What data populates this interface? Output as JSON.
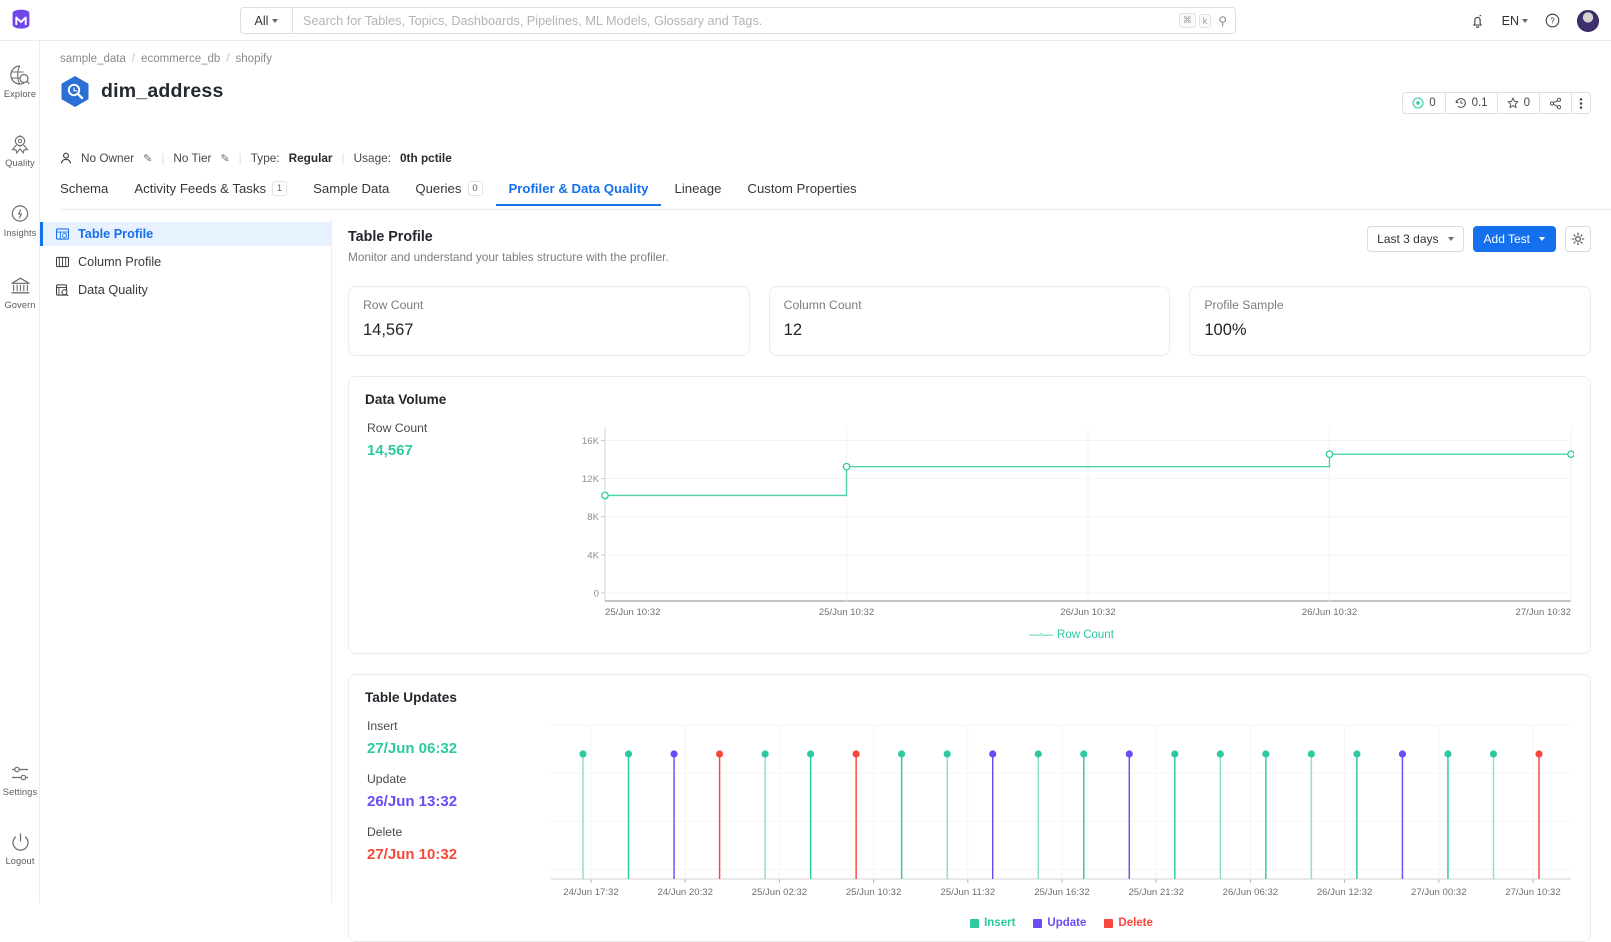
{
  "topbar": {
    "logo_name": "openmetadata-logo",
    "search_scope": "All",
    "search_placeholder": "Search for Tables, Topics, Dashboards, Pipelines, ML Models, Glossary and Tags.",
    "kbd_primary": "⌘",
    "kbd_secondary": "k",
    "bell_icon": "notification-bell-icon",
    "language": "EN",
    "help_icon": "help-circle-icon",
    "avatar_name": "user-avatar"
  },
  "rail": {
    "items": [
      {
        "label": "Explore",
        "icon": "globe-search-icon"
      },
      {
        "label": "Quality",
        "icon": "quality-badge-icon"
      },
      {
        "label": "Insights",
        "icon": "lightbulb-icon"
      },
      {
        "label": "Govern",
        "icon": "bank-icon"
      }
    ],
    "bottom": [
      {
        "label": "Settings",
        "icon": "settings-slider-icon"
      },
      {
        "label": "Logout",
        "icon": "logout-icon"
      }
    ]
  },
  "breadcrumb": [
    "sample_data",
    "ecommerce_db",
    "shopify"
  ],
  "entity": {
    "name": "dim_address",
    "icon": "bigquery-service-icon",
    "owner": "No Owner",
    "tier": "No Tier",
    "type_label": "Type:",
    "type_value": "Regular",
    "usage_label": "Usage:",
    "usage_value": "0th pctile"
  },
  "actionbar": {
    "items": [
      {
        "name": "announcement-count",
        "icon": "target-icon",
        "value": "0"
      },
      {
        "name": "version-count",
        "icon": "history-icon",
        "value": "0.1"
      },
      {
        "name": "follower-count",
        "icon": "star-icon",
        "value": "0"
      },
      {
        "name": "share-button",
        "icon": "share-icon",
        "value": ""
      },
      {
        "name": "more-menu",
        "icon": "kebab-menu-icon",
        "value": ""
      }
    ]
  },
  "tabs": [
    {
      "label": "Schema",
      "active": false,
      "count": null
    },
    {
      "label": "Activity Feeds & Tasks",
      "active": false,
      "count": "1"
    },
    {
      "label": "Sample Data",
      "active": false,
      "count": null
    },
    {
      "label": "Queries",
      "active": false,
      "count": "0"
    },
    {
      "label": "Profiler & Data Quality",
      "active": true,
      "count": null
    },
    {
      "label": "Lineage",
      "active": false,
      "count": null
    },
    {
      "label": "Custom Properties",
      "active": false,
      "count": null
    }
  ],
  "leftnav": [
    {
      "label": "Table Profile",
      "icon": "table-profile-icon",
      "active": true
    },
    {
      "label": "Column Profile",
      "icon": "column-profile-icon",
      "active": false
    },
    {
      "label": "Data Quality",
      "icon": "data-quality-icon",
      "active": false
    }
  ],
  "profile_header": {
    "title": "Table Profile",
    "subtitle": "Monitor and understand your tables structure with the profiler.",
    "date_filter": "Last 3 days",
    "add_test": "Add Test",
    "settings_icon": "gear-icon"
  },
  "stats": [
    {
      "key": "Row Count",
      "value": "14,567"
    },
    {
      "key": "Column Count",
      "value": "12"
    },
    {
      "key": "Profile Sample",
      "value": "100%"
    }
  ],
  "data_volume": {
    "title": "Data Volume",
    "summary_key": "Row Count",
    "summary_value": "14,567",
    "summary_color": "#2dc9a0"
  },
  "table_updates": {
    "title": "Table Updates",
    "metrics": [
      {
        "key": "Insert",
        "value": "27/Jun 06:32",
        "color": "#2dc9a0"
      },
      {
        "key": "Update",
        "value": "26/Jun 13:32",
        "color": "#6c4bf4"
      },
      {
        "key": "Delete",
        "value": "27/Jun 10:32",
        "color": "#f5483b"
      }
    ],
    "legend": [
      {
        "label": "Insert",
        "color": "#2dc9a0"
      },
      {
        "label": "Update",
        "color": "#6c4bf4"
      },
      {
        "label": "Delete",
        "color": "#f5483b"
      }
    ]
  },
  "chart_data": [
    {
      "type": "line",
      "name": "data-volume-chart",
      "title": "Data Volume",
      "xlabel": "",
      "ylabel": "",
      "grid": true,
      "legend_position": "bottom",
      "legend": [
        "Row Count"
      ],
      "line_color": "#2dc9a0",
      "step": true,
      "ylim": [
        0,
        17000
      ],
      "yticks": [
        0,
        4000,
        8000,
        12000,
        16000
      ],
      "ytick_labels": [
        "0",
        "4K",
        "8K",
        "12K",
        "16K"
      ],
      "xtick_labels": [
        "25/Jun 10:32",
        "25/Jun 10:32",
        "26/Jun 10:32",
        "26/Jun 10:32",
        "27/Jun 10:32"
      ],
      "series": [
        {
          "name": "Row Count",
          "points": [
            {
              "x": "25/Jun 10:32",
              "y": 10234
            },
            {
              "x": "25/Jun 10:32",
              "y": 13256
            },
            {
              "x": "26/Jun 10:32",
              "y": 13256
            },
            {
              "x": "26/Jun 10:32",
              "y": 14567
            },
            {
              "x": "27/Jun 10:32",
              "y": 14567
            }
          ]
        }
      ]
    },
    {
      "type": "scatter",
      "name": "table-updates-chart",
      "title": "Table Updates",
      "xlabel": "",
      "ylabel": "",
      "grid": true,
      "legend_position": "bottom",
      "legend": [
        "Insert",
        "Update",
        "Delete"
      ],
      "colors": {
        "Insert": "#2dc9a0",
        "Update": "#6c4bf4",
        "Delete": "#f5483b"
      },
      "xtick_labels": [
        "24/Jun 17:32",
        "24/Jun 20:32",
        "25/Jun 02:32",
        "25/Jun 10:32",
        "25/Jun 11:32",
        "25/Jun 16:32",
        "25/Jun 21:32",
        "26/Jun 06:32",
        "26/Jun 12:32",
        "27/Jun 00:32",
        "27/Jun 10:32"
      ],
      "events": [
        {
          "index": 0,
          "type": "Insert"
        },
        {
          "index": 1,
          "type": "Insert"
        },
        {
          "index": 2,
          "type": "Update"
        },
        {
          "index": 3,
          "type": "Delete"
        },
        {
          "index": 4,
          "type": "Insert"
        },
        {
          "index": 5,
          "type": "Insert"
        },
        {
          "index": 6,
          "type": "Delete"
        },
        {
          "index": 7,
          "type": "Insert"
        },
        {
          "index": 8,
          "type": "Insert"
        },
        {
          "index": 9,
          "type": "Update"
        },
        {
          "index": 10,
          "type": "Insert"
        },
        {
          "index": 11,
          "type": "Insert"
        },
        {
          "index": 12,
          "type": "Update"
        },
        {
          "index": 13,
          "type": "Insert"
        },
        {
          "index": 14,
          "type": "Insert"
        },
        {
          "index": 15,
          "type": "Insert"
        },
        {
          "index": 16,
          "type": "Insert"
        },
        {
          "index": 17,
          "type": "Insert"
        },
        {
          "index": 18,
          "type": "Update"
        },
        {
          "index": 19,
          "type": "Insert"
        },
        {
          "index": 20,
          "type": "Insert"
        },
        {
          "index": 21,
          "type": "Delete"
        }
      ]
    }
  ]
}
